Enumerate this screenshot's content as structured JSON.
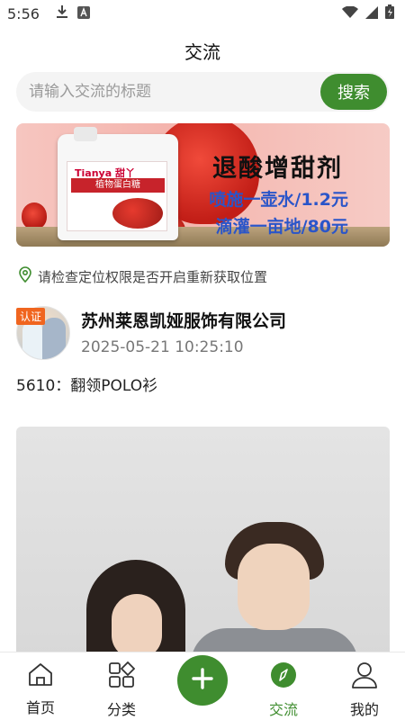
{
  "status_bar": {
    "time": "5:56"
  },
  "header": {
    "title": "交流"
  },
  "search": {
    "placeholder": "请输入交流的标题",
    "button_label": "搜索"
  },
  "banner": {
    "headline": "退酸增甜剂",
    "line1": "喷施一壶水/1.2元",
    "line2": "滴灌一亩地/80元",
    "product_brand": "Tianya 甜丫",
    "product_name": "植物蛋白糖"
  },
  "location_note": "请检查定位权限是否开启重新获取位置",
  "post": {
    "badge": "认证",
    "company": "苏州莱恩凯娅服饰有限公司",
    "time": "2025-05-21 10:25:10",
    "title": "5610：翻领POLO衫"
  },
  "tabbar": {
    "items": [
      {
        "label": "首页",
        "icon": "home-icon"
      },
      {
        "label": "分类",
        "icon": "category-icon"
      },
      {
        "label": "",
        "icon": "plus-icon"
      },
      {
        "label": "交流",
        "icon": "compass-icon"
      },
      {
        "label": "我的",
        "icon": "user-icon"
      }
    ]
  },
  "colors": {
    "accent": "#3f8d2f",
    "badge": "#f0651f"
  }
}
